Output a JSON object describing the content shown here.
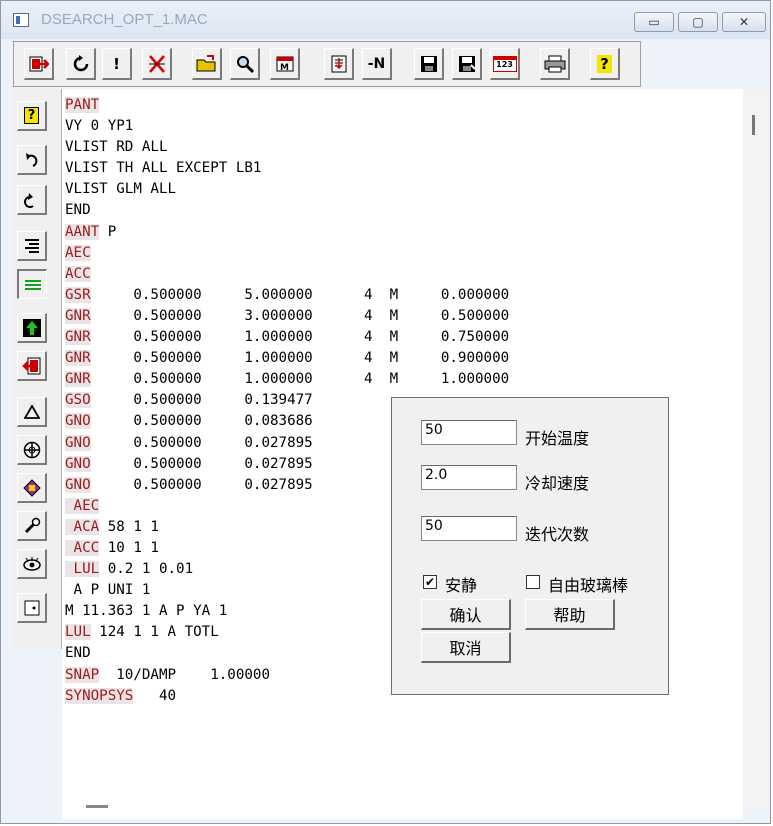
{
  "window": {
    "title": "DSEARCH_OPT_1.MAC",
    "controls": {
      "minimize": "▭",
      "maximize": "▢",
      "close": "✕"
    }
  },
  "toolbar": {
    "icons": [
      "exit-icon",
      "refresh-icon",
      "execute-icon",
      "cut-icon",
      "open-folder-icon",
      "find-icon",
      "macro-icon",
      "paste-icon",
      "renumber-icon",
      "save-icon",
      "save-as-icon",
      "line-number-icon",
      "print-icon",
      "help-icon"
    ],
    "execute_label": "!",
    "renumber_label": "-N",
    "line_number_label": "123",
    "help_label": "?"
  },
  "leftbar": {
    "icons": [
      "help-icon",
      "undo-icon",
      "redo-icon",
      "align-right-icon",
      "lines-icon",
      "up-arrow-icon",
      "exit-window-icon",
      "triangle-icon",
      "target-icon",
      "optimize-icon",
      "wrench-icon",
      "eye-icon",
      "dot-frame-icon"
    ],
    "help_label": "?"
  },
  "editor": {
    "lines": [
      {
        "kw": "PANT",
        "rest": ""
      },
      {
        "kw": "",
        "rest": "VY 0 YP1"
      },
      {
        "kw": "",
        "rest": "VLIST RD ALL"
      },
      {
        "kw": "",
        "rest": "VLIST TH ALL EXCEPT LB1"
      },
      {
        "kw": "",
        "rest": "VLIST GLM ALL"
      },
      {
        "kw": "",
        "rest": "END"
      },
      {
        "kw": "AANT",
        "rest": " P"
      },
      {
        "kw": "AEC",
        "rest": ""
      },
      {
        "kw": "ACC",
        "rest": ""
      },
      {
        "kw": "GSR",
        "rest": "     0.500000     5.000000      4  M     0.000000"
      },
      {
        "kw": "GNR",
        "rest": "     0.500000     3.000000      4  M     0.500000"
      },
      {
        "kw": "GNR",
        "rest": "     0.500000     1.000000      4  M     0.750000"
      },
      {
        "kw": "GNR",
        "rest": "     0.500000     1.000000      4  M     0.900000"
      },
      {
        "kw": "GNR",
        "rest": "     0.500000     1.000000      4  M     1.000000"
      },
      {
        "kw": "GSO",
        "rest": "     0.500000     0.139477"
      },
      {
        "kw": "GNO",
        "rest": "     0.500000     0.083686"
      },
      {
        "kw": "GNO",
        "rest": "     0.500000     0.027895"
      },
      {
        "kw": "GNO",
        "rest": "     0.500000     0.027895"
      },
      {
        "kw": "GNO",
        "rest": "     0.500000     0.027895"
      },
      {
        "kw": " AEC",
        "rest": ""
      },
      {
        "kw": " ACA",
        "rest": " 58 1 1"
      },
      {
        "kw": " ACC",
        "rest": " 10 1 1"
      },
      {
        "kw": " LUL",
        "rest": " 0.2 1 0.01"
      },
      {
        "kw": "",
        "rest": " A P UNI 1"
      },
      {
        "kw": "",
        "rest": "M 11.363 1 A P YA 1"
      },
      {
        "kw": "LUL",
        "rest": " 124 1 1 A TOTL"
      },
      {
        "kw": "",
        "rest": "END"
      },
      {
        "kw": "SNAP",
        "rest": "  10/DAMP    1.00000"
      },
      {
        "kw": "SYNOPSYS",
        "rest": "   40"
      }
    ]
  },
  "dialog": {
    "fields": [
      {
        "value": "50",
        "label": "开始温度"
      },
      {
        "value": "2.0",
        "label": "冷却速度"
      },
      {
        "value": "50",
        "label": "迭代次数"
      }
    ],
    "quiet": {
      "label": "安静",
      "checked": true,
      "mark": "✔"
    },
    "free_glass": {
      "label": "自由玻璃棒",
      "checked": false
    },
    "confirm": "确认",
    "help": "帮助",
    "cancel": "取消"
  },
  "colors": {
    "keyword": "#9b1b1b",
    "keyword_bg": "#ebe4e6"
  }
}
